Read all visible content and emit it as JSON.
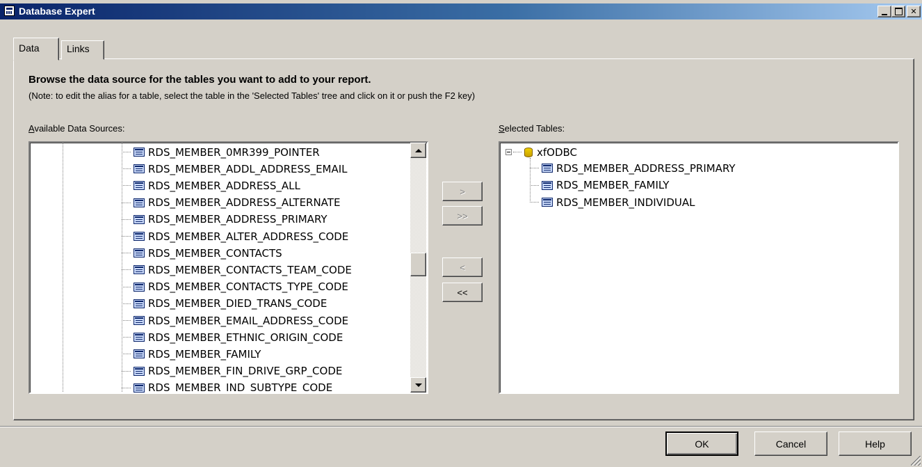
{
  "window": {
    "title": "Database Expert"
  },
  "tabs": [
    {
      "label": "Data",
      "active": true
    },
    {
      "label": "Links",
      "active": false
    }
  ],
  "heading": "Browse the data source for the tables you want to add to your report.",
  "note": "(Note: to edit the alias for a table, select the table in the 'Selected Tables' tree and click on it or push the F2 key)",
  "available": {
    "label_first": "A",
    "label_rest": "vailable Data Sources:",
    "items": [
      "RDS_MEMBER_0MR399_POINTER",
      "RDS_MEMBER_ADDL_ADDRESS_EMAIL",
      "RDS_MEMBER_ADDRESS_ALL",
      "RDS_MEMBER_ADDRESS_ALTERNATE",
      "RDS_MEMBER_ADDRESS_PRIMARY",
      "RDS_MEMBER_ALTER_ADDRESS_CODE",
      "RDS_MEMBER_CONTACTS",
      "RDS_MEMBER_CONTACTS_TEAM_CODE",
      "RDS_MEMBER_CONTACTS_TYPE_CODE",
      "RDS_MEMBER_DIED_TRANS_CODE",
      "RDS_MEMBER_EMAIL_ADDRESS_CODE",
      "RDS_MEMBER_ETHNIC_ORIGIN_CODE",
      "RDS_MEMBER_FAMILY",
      "RDS_MEMBER_FIN_DRIVE_GRP_CODE",
      "RDS_MEMBER_IND_SUBTYPE_CODE"
    ]
  },
  "selected": {
    "label_first": "S",
    "label_rest": "elected Tables:",
    "root": "xfODBC",
    "items": [
      "RDS_MEMBER_ADDRESS_PRIMARY",
      "RDS_MEMBER_FAMILY",
      "RDS_MEMBER_INDIVIDUAL"
    ]
  },
  "move_buttons": {
    "add": ">",
    "add_all": ">>",
    "remove": "<",
    "remove_all": "<<"
  },
  "buttons": {
    "ok": "OK",
    "cancel": "Cancel",
    "help": "Help"
  },
  "colors": {
    "titlebar_start": "#0a246a",
    "titlebar_end": "#a6caf0",
    "dialog_face": "#d4d0c8"
  },
  "icons": {
    "table": "table-icon",
    "database": "database-icon"
  }
}
